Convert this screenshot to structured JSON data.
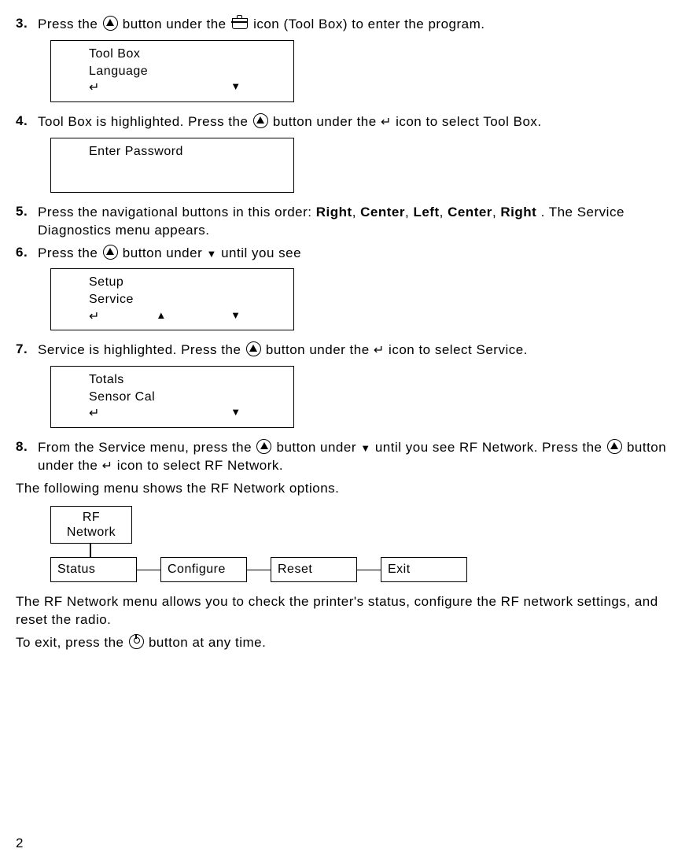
{
  "steps": {
    "s3": {
      "num": "3.",
      "t_before_btn": "Press the ",
      "t_mid1": " button under the ",
      "t_end": " icon (Tool Box) to enter the program."
    },
    "box3": {
      "l1": "Tool Box",
      "l2": "Language",
      "enter": "↵",
      "down": "▼"
    },
    "s4": {
      "num": "4.",
      "t_before": "Tool Box is highlighted.  Press the ",
      "t_mid": " button under the ",
      "enter": "↵",
      "t_end": " icon to select Tool Box."
    },
    "box4": {
      "l1": "Enter Password"
    },
    "s5": {
      "num": "5.",
      "t_a": "Press the navigational buttons in this order:  ",
      "w1": "Right",
      "c1": ", ",
      "w2": "Center",
      "c2": ", ",
      "w3": "Left",
      "c3": ", ",
      "w4": "Center",
      "c4": ", ",
      "w5": "Right",
      "t_b": ".  The Service Diagnostics menu appears."
    },
    "s6": {
      "num": "6.",
      "t_before": "Press the ",
      "t_mid": " button under ",
      "down": "▼",
      "t_end": " until you see"
    },
    "box6": {
      "l1": "Setup",
      "l2": "Service",
      "enter": "↵",
      "up": "▲",
      "down": "▼"
    },
    "s7": {
      "num": "7.",
      "t_before": "Service is highlighted.  Press the ",
      "t_mid": " button under the ",
      "enter": "↵",
      "t_end": " icon to select Service."
    },
    "box7": {
      "l1": "Totals",
      "l2": "Sensor Cal",
      "enter": "↵",
      "down": "▼"
    },
    "s8": {
      "num": "8.",
      "t_a": "From the Service menu, press the ",
      "t_b": " button under ",
      "down": "▼",
      "t_c": " until you see RF Network.  Press the ",
      "t_d": " button under the ",
      "enter": "↵",
      "t_e": " icon to select RF Network."
    }
  },
  "para1": "The following menu shows the RF Network options.",
  "tree": {
    "top1": "RF",
    "top2": "Network",
    "b1": "Status",
    "b2": "Configure",
    "b3": "Reset",
    "b4": "Exit"
  },
  "para2": "The RF Network menu allows you to check the printer's status, configure the RF network settings, and reset the radio.",
  "para3_a": "To exit, press the ",
  "para3_b": " button at any time.",
  "pagenum": "2"
}
